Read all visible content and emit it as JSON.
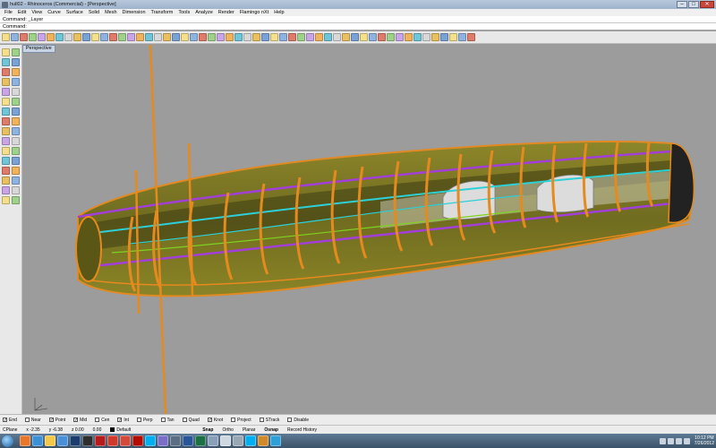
{
  "window": {
    "title": "hull02 - Rhinoceros (Commercial) - [Perspective]",
    "controls": {
      "minimize": "–",
      "maximize": "□",
      "close": "✕"
    }
  },
  "menubar": {
    "items": [
      "File",
      "Edit",
      "View",
      "Curve",
      "Surface",
      "Solid",
      "Mesh",
      "Dimension",
      "Transform",
      "Tools",
      "Analyze",
      "Render",
      "Flamingo nXt",
      "Help"
    ]
  },
  "command": {
    "history": "Command: _Layer",
    "prompt": "Command:",
    "value": ""
  },
  "toolbar": {
    "icons": [
      "new-file-icon",
      "open-file-icon",
      "save-icon",
      "print-icon",
      "import-icon",
      "cut-icon",
      "copy-icon",
      "paste-icon",
      "undo-icon",
      "redo-icon",
      "pan-icon",
      "rotate-view-icon",
      "zoom-icon",
      "zoom-window-icon",
      "zoom-extents-icon",
      "zoom-selected-icon",
      "four-viewports-icon",
      "grid-icon",
      "cplane-icon",
      "select-all-icon",
      "lock-icon",
      "light-bulb-icon",
      "layer-icon",
      "properties-icon",
      "render-color-icon",
      "render-icon",
      "shaded-sphere-icon",
      "wireframe-sphere-icon",
      "globe-icon",
      "options-icon",
      "dimension-icon",
      "text-icon",
      "mesh-icon",
      "curve-icon",
      "surface-icon",
      "solid-icon",
      "boolean-icon",
      "analyze-icon",
      "transform-icon",
      "mirror-icon",
      "array-icon",
      "scale-icon",
      "move-icon",
      "join-icon",
      "explode-icon",
      "trim-icon",
      "split-icon",
      "extend-icon",
      "fillet-icon",
      "chamfer-icon",
      "offset-icon",
      "project-icon",
      "help-icon"
    ]
  },
  "left_toolbar": {
    "icons": [
      "select-arrow-icon",
      "point-icon",
      "polyline-icon",
      "curve-icon",
      "arc-icon",
      "circle-icon",
      "ellipse-icon",
      "rectangle-icon",
      "polygon-icon",
      "freeform-icon",
      "surface-icon",
      "plane-icon",
      "extrude-icon",
      "loft-icon",
      "solid-box-icon",
      "sphere-icon",
      "mesh-icon",
      "boolean-icon",
      "fillet-icon",
      "trim-icon",
      "split-icon",
      "join-icon",
      "explode-icon",
      "move-icon",
      "copy-icon",
      "rotate-icon",
      "scale-icon",
      "mirror-icon",
      "array-icon",
      "grip-icon",
      "analyze-icon",
      "dimension-icon"
    ]
  },
  "viewport": {
    "tab": "Perspective"
  },
  "osnaps": [
    {
      "label": "End",
      "checked": true
    },
    {
      "label": "Near",
      "checked": false
    },
    {
      "label": "Point",
      "checked": true
    },
    {
      "label": "Mid",
      "checked": true
    },
    {
      "label": "Cen",
      "checked": false
    },
    {
      "label": "Int",
      "checked": true
    },
    {
      "label": "Perp",
      "checked": false
    },
    {
      "label": "Tan",
      "checked": false
    },
    {
      "label": "Quad",
      "checked": false
    },
    {
      "label": "Knot",
      "checked": true
    },
    {
      "label": "Project",
      "checked": false
    },
    {
      "label": "STrack",
      "checked": false
    },
    {
      "label": "Disable",
      "checked": false
    }
  ],
  "status": {
    "cplane": "CPlane",
    "x": "x -2.35",
    "y": "y -6.38",
    "z": "z 0.00",
    "units": "0.00",
    "layer": "Default",
    "snap": "Snap",
    "ortho": "Ortho",
    "planar": "Planar",
    "osnap": "Osnap",
    "record": "Record History"
  },
  "taskbar": {
    "apps": [
      "firefox-icon",
      "media-player-icon",
      "folder-icon",
      "explorer-icon",
      "photoshop-icon",
      "maya-icon",
      "rhino-icon",
      "flamingo-icon",
      "chrome-icon",
      "acrobat-icon",
      "skype-icon",
      "paint-icon",
      "calculator-icon",
      "word-icon",
      "excel-icon",
      "network-icon",
      "notepad-icon",
      "settings-icon",
      "skype-icon",
      "email-icon",
      "globe-icon"
    ],
    "time": "10:12 PM",
    "date": "7/26/2012"
  },
  "colors": {
    "viewport_bg": "#9c9c9c",
    "hull_fill": "#6e6a1a",
    "frames": "#e58a1e",
    "stringer_purple": "#a23fd6",
    "stringer_cyan": "#2ed0d8",
    "keel_green": "#7ed321"
  }
}
